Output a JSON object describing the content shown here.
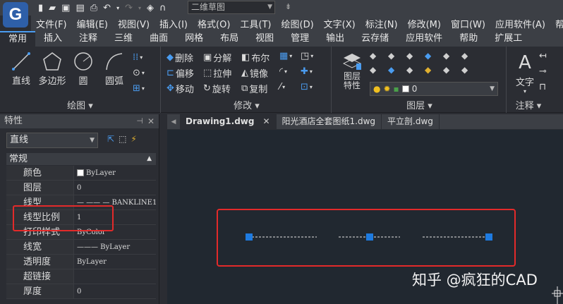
{
  "app": {
    "logo_letter": "G",
    "workspace": "二维草图"
  },
  "menu": [
    "文件(F)",
    "编辑(E)",
    "视图(V)",
    "插入(I)",
    "格式(O)",
    "工具(T)",
    "绘图(D)",
    "文字(X)",
    "标注(N)",
    "修改(M)",
    "窗口(W)",
    "应用软件(A)",
    "帮助(H)"
  ],
  "ribbon_tabs": [
    "常用",
    "插入",
    "注释",
    "三维",
    "曲面",
    "网格",
    "布局",
    "视图",
    "管理",
    "输出",
    "云存储",
    "应用软件",
    "帮助",
    "扩展工"
  ],
  "draw_panel": {
    "title": "绘图",
    "line": "直线",
    "polygon": "多边形",
    "circle": "圆",
    "arc": "圆弧"
  },
  "modify_panel": {
    "title": "修改",
    "erase": "删除",
    "explode": "分解",
    "boolean": "布尔",
    "offset": "偏移",
    "stretch": "拉伸",
    "mirror": "镜像",
    "move": "移动",
    "rotate": "旋转",
    "copy": "复制"
  },
  "layer_panel": {
    "title": "图层",
    "props_label": "图层\n特性",
    "current_layer": "0"
  },
  "annot_panel": {
    "title": "注释",
    "text": "文字"
  },
  "properties": {
    "title": "特性",
    "selected": "直线",
    "group": "常规",
    "rows": [
      {
        "key": "颜色",
        "value": "ByLayer"
      },
      {
        "key": "图层",
        "value": "0"
      },
      {
        "key": "线型",
        "value": "— —— — BANKLINE1"
      },
      {
        "key": "线型比例",
        "value": "1"
      },
      {
        "key": "打印样式",
        "value": "ByColor"
      },
      {
        "key": "线宽",
        "value": "——— ByLayer"
      },
      {
        "key": "透明度",
        "value": "ByLayer"
      },
      {
        "key": "超链接",
        "value": ""
      },
      {
        "key": "厚度",
        "value": "0"
      }
    ]
  },
  "doc_tabs": [
    {
      "label": "Drawing1.dwg",
      "active": true
    },
    {
      "label": "阳光酒店全套图纸1.dwg",
      "active": false
    },
    {
      "label": "平立剖.dwg",
      "active": false
    }
  ],
  "watermark": "知乎 @疯狂的CAD",
  "colors": {
    "accent": "#4a9cf0",
    "highlight": "#e32a2a",
    "grip": "#1e7be0",
    "canvas": "#212830"
  }
}
